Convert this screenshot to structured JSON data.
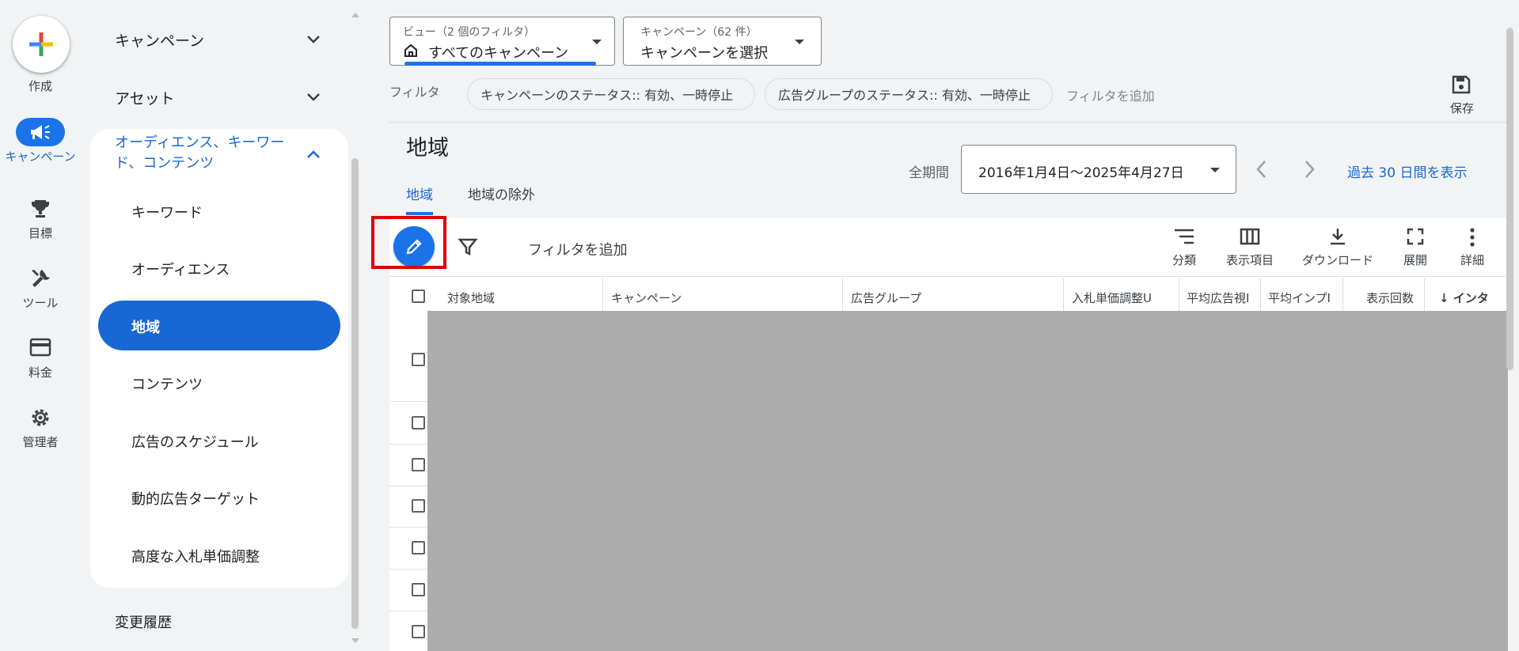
{
  "rail": {
    "create_label": "作成",
    "items": [
      {
        "label": "キャンペーン",
        "icon": "megaphone-icon",
        "active": true
      },
      {
        "label": "目標",
        "icon": "trophy-icon"
      },
      {
        "label": "ツール",
        "icon": "tools-icon"
      },
      {
        "label": "料金",
        "icon": "credit-card-icon"
      },
      {
        "label": "管理者",
        "icon": "gear-icon"
      }
    ]
  },
  "nav": {
    "campaigns": "キャンペーン",
    "assets": "アセット",
    "audiences_line1": "オーディエンス、キーワー",
    "audiences_line2": "ド、コンテンツ",
    "sub_items": [
      "キーワード",
      "オーディエンス",
      "地域",
      "コンテンツ",
      "広告のスケジュール",
      "動的広告ターゲット",
      "高度な入札単価調整"
    ],
    "active_item": "地域",
    "change_history": "変更履歴"
  },
  "view_dropdown": {
    "label": "ビュー（2 個のフィルタ）",
    "value": "すべてのキャンペーン"
  },
  "campaign_dropdown": {
    "label": "キャンペーン（62 件）",
    "value": "キャンペーンを選択"
  },
  "filter_bar": {
    "label": "フィルタ",
    "chips": [
      "キャンペーンのステータス:: 有効、一時停止",
      "広告グループのステータス:: 有効、一時停止"
    ],
    "add_filter": "フィルタを追加",
    "save": "保存"
  },
  "page": {
    "title": "地域",
    "tabs": [
      "地域",
      "地域の除外"
    ],
    "period_label": "全期間",
    "date_range": "2016年1月4日～2025年4月27日",
    "show_last_30": "過去 30 日間を表示"
  },
  "toolbar": {
    "add_filter": "フィルタを追加",
    "segment": "分類",
    "columns": "表示項目",
    "download": "ダウンロード",
    "expand": "展開",
    "more": "詳細"
  },
  "table": {
    "headers": [
      "対象地域",
      "キャンペーン",
      "広告グループ",
      "入札単価調整U",
      "平均広告視I",
      "平均インプI",
      "表示回数",
      "↓ インタ"
    ]
  },
  "colors": {
    "accent": "#1a73e8",
    "highlight_box": "#e00000"
  }
}
